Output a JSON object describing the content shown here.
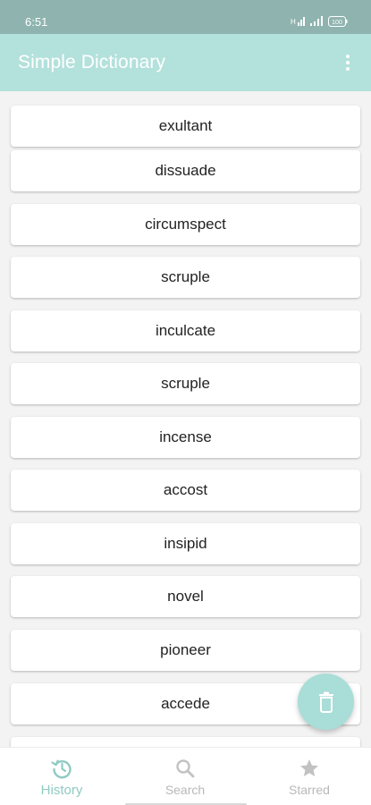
{
  "status_bar": {
    "time": "6:51",
    "battery_text": "100"
  },
  "app_bar": {
    "title": "Simple Dictionary",
    "overflow_icon": "more-vert-icon"
  },
  "history": {
    "words": [
      "exultant",
      "dissuade",
      "circumspect",
      "scruple",
      "inculcate",
      "scruple",
      "incense",
      "accost",
      "insipid",
      "novel",
      "pioneer",
      "accede"
    ]
  },
  "fab": {
    "icon": "trash-icon"
  },
  "bottom_nav": {
    "items": [
      {
        "label": "History",
        "icon": "history-icon",
        "active": true
      },
      {
        "label": "Search",
        "icon": "search-icon",
        "active": false
      },
      {
        "label": "Starred",
        "icon": "star-icon",
        "active": false
      }
    ]
  },
  "colors": {
    "status_bar": "#8fb4b0",
    "app_bar": "#b3e1dc",
    "accent": "#8fcac3",
    "fab": "#a9ddd7",
    "background": "#f3f3f3"
  }
}
